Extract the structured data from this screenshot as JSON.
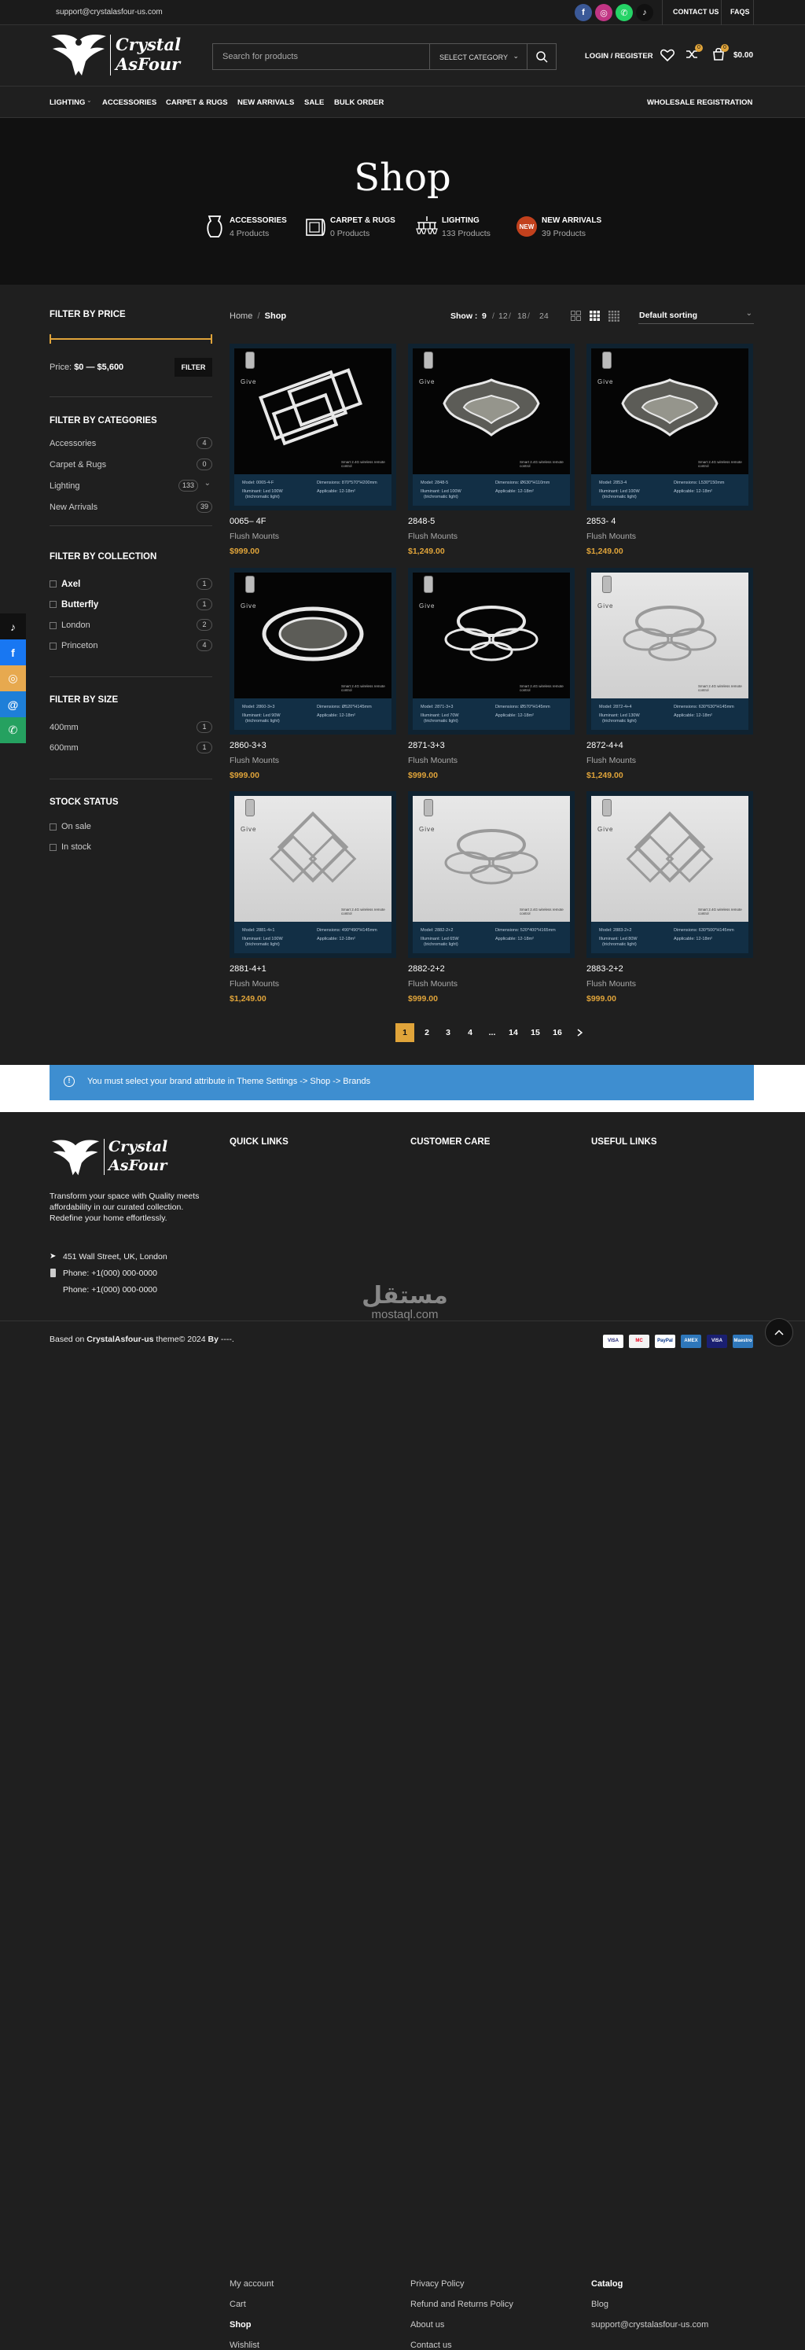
{
  "topbar": {
    "email": "support@crystalasfour-us.com",
    "contact": "CONTACT US",
    "faqs": "FAQS",
    "social": [
      {
        "icon": "facebook-icon",
        "glyph": "f",
        "color": "#3b5998"
      },
      {
        "icon": "instagram-icon",
        "glyph": "◎",
        "color": "#c13584"
      },
      {
        "icon": "whatsapp-icon",
        "glyph": "✆",
        "color": "#25d366"
      },
      {
        "icon": "tiktok-icon",
        "glyph": "♪",
        "color": "#111111"
      }
    ]
  },
  "header": {
    "logo_line1": "Crystal",
    "logo_line2": "AsFour",
    "search_placeholder": "Search for products",
    "select_category": "SELECT CATEGORY",
    "login": "LOGIN / REGISTER",
    "wishlist_count": "0",
    "compare_count": "0",
    "cart_count": "0",
    "cart_total": "$0.00"
  },
  "nav": {
    "items": [
      "LIGHTING",
      "ACCESSORIES",
      "CARPET & RUGS",
      "NEW ARRIVALS",
      "SALE",
      "BULK ORDER"
    ],
    "right": "WHOLESALE REGISTRATION"
  },
  "hero": {
    "title": "Shop",
    "categories": [
      {
        "name": "ACCESSORIES",
        "count": "4 Products",
        "icon": "vase-icon"
      },
      {
        "name": "CARPET & RUGS",
        "count": "0 Products",
        "icon": "rug-icon"
      },
      {
        "name": "LIGHTING",
        "count": "133 Products",
        "icon": "chandelier-icon"
      },
      {
        "name": "NEW ARRIVALS",
        "count": "39 Products",
        "icon": "new-badge-icon"
      }
    ]
  },
  "sidebar": {
    "price_title": "FILTER BY PRICE",
    "price_label": "Price:",
    "price_range": "$0 — $5,600",
    "filter_button": "FILTER",
    "categories_title": "FILTER BY CATEGORIES",
    "categories": [
      {
        "name": "Accessories",
        "count": "4"
      },
      {
        "name": "Carpet & Rugs",
        "count": "0"
      },
      {
        "name": "Lighting",
        "count": "133"
      },
      {
        "name": "New Arrivals",
        "count": "39"
      }
    ],
    "collection_title": "FILTER BY COLLECTION",
    "collections": [
      {
        "name": "Axel",
        "count": "1"
      },
      {
        "name": "Butterfly",
        "count": "1"
      },
      {
        "name": "London",
        "count": "2"
      },
      {
        "name": "Princeton",
        "count": "4"
      }
    ],
    "size_title": "FILTER BY SIZE",
    "sizes": [
      {
        "name": "400mm",
        "count": "1"
      },
      {
        "name": "600mm",
        "count": "1"
      }
    ],
    "stock_title": "STOCK STATUS",
    "stock": [
      "On sale",
      "In stock"
    ]
  },
  "shop": {
    "breadcrumb_home": "Home",
    "breadcrumb_current": "Shop",
    "show_label": "Show :",
    "show_options": [
      "9",
      "12",
      "18",
      "24"
    ],
    "sorting": "Default sorting",
    "products": [
      {
        "name": "0065– 4F",
        "cat": "Flush Mounts",
        "price": "$999.00",
        "bg": "dark",
        "shape": "rects",
        "model": "Model: 0065-4-F",
        "dim": "Dimensions: 870*570*H200mm",
        "ill": "Illuminant: Led 100W",
        "app": "Applicable: 12-18m²"
      },
      {
        "name": "2848-5",
        "cat": "Flush Mounts",
        "price": "$1,249.00",
        "bg": "dark",
        "shape": "petals",
        "model": "Model: 2848-5",
        "dim": "Dimensions: Ø630*H110mm",
        "ill": "Illuminant: Led 100W",
        "app": "Applicable: 12-18m²"
      },
      {
        "name": "2853- 4",
        "cat": "Flush Mounts",
        "price": "$1,249.00",
        "bg": "dark",
        "shape": "petals",
        "model": "Model: 2853-4",
        "dim": "Dimensions: L530*150mm",
        "ill": "Illuminant: Led 100W",
        "app": "Applicable: 12-18m²"
      },
      {
        "name": "2860-3+3",
        "cat": "Flush Mounts",
        "price": "$999.00",
        "bg": "dark",
        "shape": "ring",
        "model": "Model: 2860-3+3",
        "dim": "Dimensions: Ø520*H145mm",
        "ill": "Illuminant: Led 90W",
        "app": "Applicable: 12-18m²"
      },
      {
        "name": "2871-3+3",
        "cat": "Flush Mounts",
        "price": "$999.00",
        "bg": "dark",
        "shape": "rings",
        "model": "Model: 2871-3+3",
        "dim": "Dimensions: Ø570*H145mm",
        "ill": "Illuminant: Led 70W",
        "app": "Applicable: 12-18m²"
      },
      {
        "name": "2872-4+4",
        "cat": "Flush Mounts",
        "price": "$1,249.00",
        "bg": "light",
        "shape": "rings",
        "model": "Model: 2872-4+4",
        "dim": "Dimensions: 630*630*H145mm",
        "ill": "Illuminant: Led 130W",
        "app": "Applicable: 12-18m²"
      },
      {
        "name": "2881-4+1",
        "cat": "Flush Mounts",
        "price": "$1,249.00",
        "bg": "light",
        "shape": "squares",
        "model": "Model: 2881-4+1",
        "dim": "Dimensions: 490*490*H145mm",
        "ill": "Illuminant: Led 100W",
        "app": "Applicable: 12-18m²"
      },
      {
        "name": "2882-2+2",
        "cat": "Flush Mounts",
        "price": "$999.00",
        "bg": "light",
        "shape": "rings",
        "model": "Model: 2882-2+2",
        "dim": "Dimensions: 520*400*H165mm",
        "ill": "Illuminant: Led 65W",
        "app": "Applicable: 12-18m²"
      },
      {
        "name": "2883-2+2",
        "cat": "Flush Mounts",
        "price": "$999.00",
        "bg": "light",
        "shape": "squares",
        "model": "Model: 2883-2+2",
        "dim": "Dimensions: 630*500*H145mm",
        "ill": "Illuminant: Led 80W",
        "app": "Applicable: 12-18m²"
      }
    ],
    "pages": [
      "1",
      "2",
      "3",
      "4",
      "...",
      "14",
      "15",
      "16"
    ],
    "current_page": "1",
    "give_label": "Give",
    "remote_label": "Smart 2.4G wireless remote control",
    "light_note": "(trichromatic light)"
  },
  "notice": "You must select your brand attribute in Theme Settings -> Shop -> Brands",
  "footer": {
    "about": "Transform your space with Quality meets affordability in our curated collection. Redefine your home effortlessly.",
    "address": "451 Wall Street, UK, London",
    "phone1": "Phone: +1(000) 000-0000",
    "phone2": "Phone: +1(000) 000-0000",
    "quick_title": "QUICK LINKS",
    "quick": [
      "My account",
      "Cart",
      "Shop",
      "Wishlist"
    ],
    "care_title": "CUSTOMER CARE",
    "care": [
      "Privacy Policy",
      "Refund and Returns Policy",
      "About us",
      "Contact us"
    ],
    "useful_title": "USEFUL LINKS",
    "useful": [
      "Catalog",
      "Blog",
      "support@crystalasfour-us.com"
    ],
    "copyright_pre": "Based on",
    "copyright_brand": "CrystalAsfour-us",
    "copyright_mid": "theme© 2024",
    "copyright_by": "By",
    "copyright_post": "----.",
    "watermark_ar": "مستقل",
    "watermark_en": "mostaql.com",
    "payments": [
      "VISA",
      "MC",
      "PayPal",
      "AMEX",
      "VISA",
      "Maestro"
    ]
  },
  "colors": {
    "accent": "#e0a43a",
    "notice": "#3e8ed0",
    "bg": "#1f1f1f"
  }
}
